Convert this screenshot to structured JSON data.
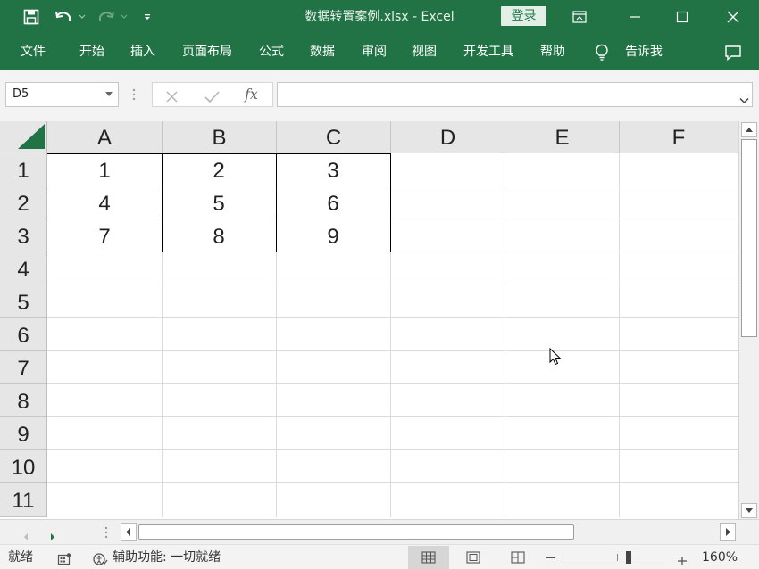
{
  "window": {
    "title": "数据转置案例.xlsx  -  Excel",
    "login_label": "登录"
  },
  "ribbon": {
    "tabs": [
      "文件",
      "开始",
      "插入",
      "页面布局",
      "公式",
      "数据",
      "审阅",
      "视图",
      "开发工具",
      "帮助"
    ],
    "tell_me": "告诉我"
  },
  "formula_bar": {
    "name_box": "D5",
    "fx_label": "fx",
    "formula": ""
  },
  "grid": {
    "columns": [
      "A",
      "B",
      "C",
      "D",
      "E",
      "F"
    ],
    "rows": [
      "1",
      "2",
      "3",
      "4",
      "5",
      "6",
      "7",
      "8",
      "9",
      "10",
      "11"
    ],
    "cells": [
      [
        "1",
        "2",
        "3"
      ],
      [
        "4",
        "5",
        "6"
      ],
      [
        "7",
        "8",
        "9"
      ]
    ]
  },
  "status": {
    "ready": "就绪",
    "accessibility": "辅助功能: 一切就绪",
    "zoom": "160%"
  },
  "colors": {
    "accent": "#217346",
    "table_border": "#000000"
  }
}
